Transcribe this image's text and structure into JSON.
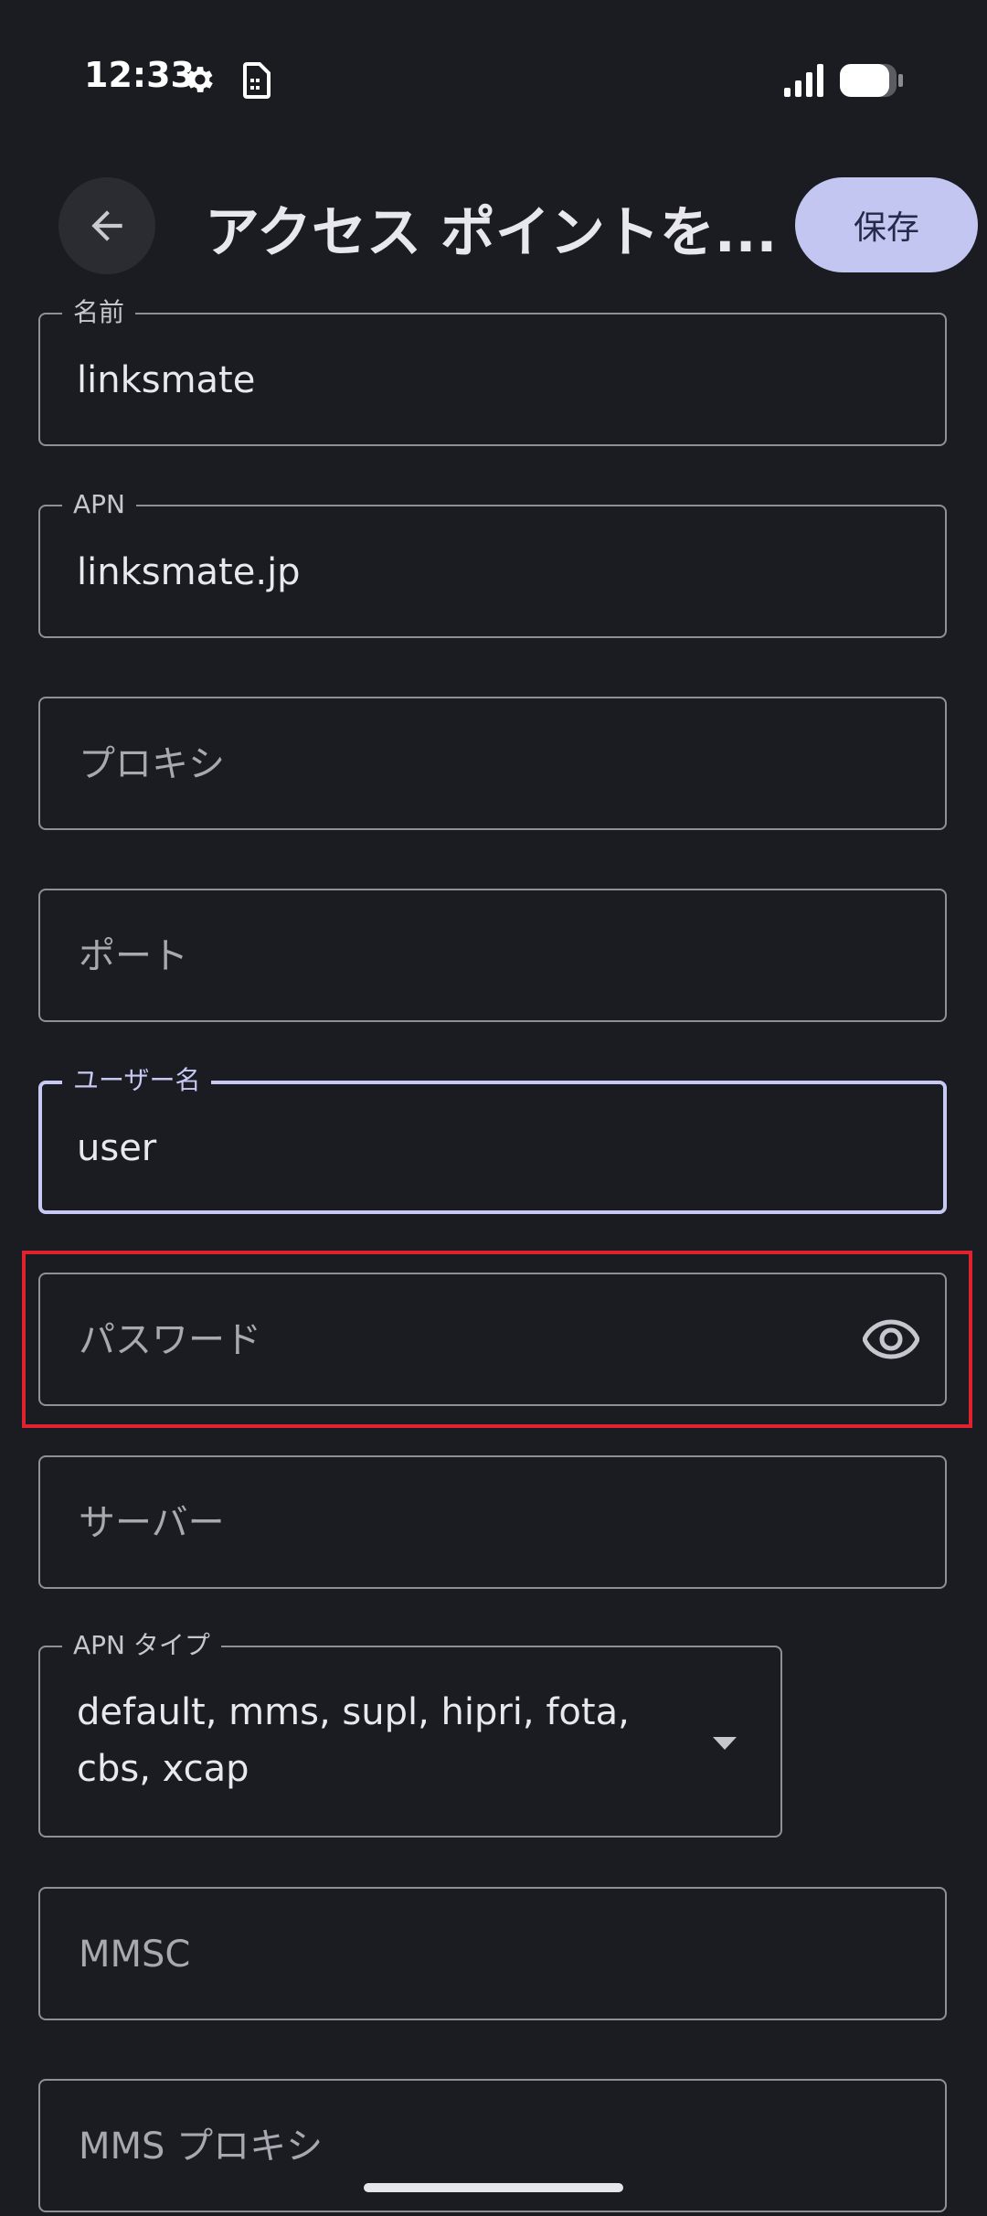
{
  "status_bar": {
    "time": "12:33",
    "icons": [
      "gear-icon",
      "sim-card-icon",
      "signal-icon",
      "battery-icon"
    ]
  },
  "app_bar": {
    "back_icon": "arrow-back-icon",
    "title": "アクセス ポイントを...",
    "save_label": "保存"
  },
  "fields": {
    "name": {
      "label": "名前",
      "value": "linksmate"
    },
    "apn": {
      "label": "APN",
      "value": "linksmate.jp"
    },
    "proxy": {
      "placeholder": "プロキシ"
    },
    "port": {
      "placeholder": "ポート"
    },
    "username": {
      "label": "ユーザー名",
      "value": "user"
    },
    "password": {
      "placeholder": "パスワード",
      "icon": "eye-icon"
    },
    "server": {
      "placeholder": "サーバー"
    },
    "apn_type": {
      "label": "APN タイプ",
      "value": "default, mms, supl, hipri, fota, cbs, xcap",
      "icon": "dropdown-arrow-icon"
    },
    "mmsc": {
      "placeholder": "MMSC"
    },
    "mms_proxy": {
      "placeholder": "MMS プロキシ"
    }
  },
  "colors": {
    "background": "#1b1c21",
    "accent": "#c3c6f0",
    "highlight": "#e0212e"
  }
}
